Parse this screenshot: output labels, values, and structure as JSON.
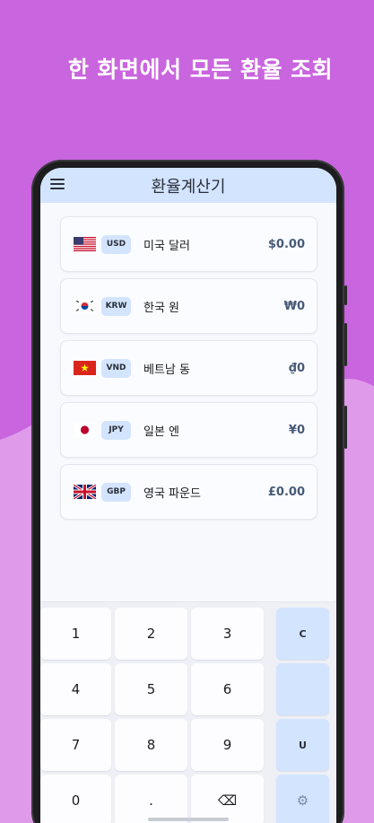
{
  "headline": "한 화면에서 모든 환율 조회",
  "app": {
    "title": "환율계산기"
  },
  "currencies": [
    {
      "code": "USD",
      "name": "미국 달러",
      "amount": "$0.00",
      "flag": "us-flag"
    },
    {
      "code": "KRW",
      "name": "한국 원",
      "amount": "₩0",
      "flag": "kr-flag"
    },
    {
      "code": "VND",
      "name": "베트남 동",
      "amount": "₫0",
      "flag": "vn-flag"
    },
    {
      "code": "JPY",
      "name": "일본 엔",
      "amount": "¥0",
      "flag": "jp-flag"
    },
    {
      "code": "GBP",
      "name": "영국 파운드",
      "amount": "£0.00",
      "flag": "gb-flag"
    }
  ],
  "keypad": {
    "k1": "1",
    "k2": "2",
    "k3": "3",
    "clear": "C",
    "k4": "4",
    "k5": "5",
    "k6": "6",
    "blank": "",
    "k7": "7",
    "k8": "8",
    "k9": "9",
    "u": "U",
    "k0": "0",
    "dot": ".",
    "backspace": "⌫",
    "settings": "⚙"
  },
  "colors": {
    "background": "#c965de",
    "appbar": "#d3e4fe",
    "amount": "#475a77"
  }
}
